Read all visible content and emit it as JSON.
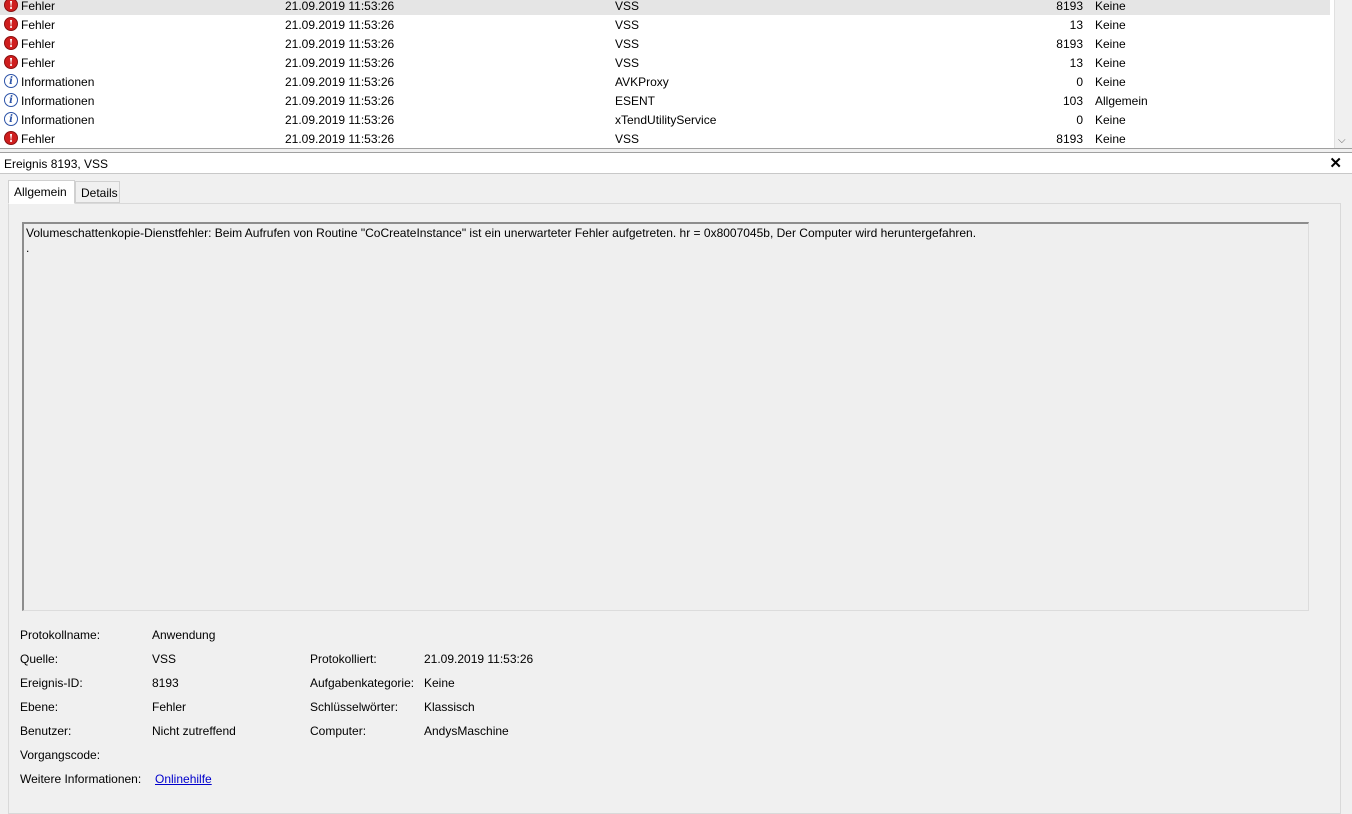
{
  "events": [
    {
      "level": "Fehler",
      "type": "error",
      "date": "21.09.2019 11:53:26",
      "source": "VSS",
      "id": "8193",
      "category": "Keine",
      "selected": true
    },
    {
      "level": "Fehler",
      "type": "error",
      "date": "21.09.2019 11:53:26",
      "source": "VSS",
      "id": "13",
      "category": "Keine"
    },
    {
      "level": "Fehler",
      "type": "error",
      "date": "21.09.2019 11:53:26",
      "source": "VSS",
      "id": "8193",
      "category": "Keine"
    },
    {
      "level": "Fehler",
      "type": "error",
      "date": "21.09.2019 11:53:26",
      "source": "VSS",
      "id": "13",
      "category": "Keine"
    },
    {
      "level": "Informationen",
      "type": "info",
      "date": "21.09.2019 11:53:26",
      "source": "AVKProxy",
      "id": "0",
      "category": "Keine"
    },
    {
      "level": "Informationen",
      "type": "info",
      "date": "21.09.2019 11:53:26",
      "source": "ESENT",
      "id": "103",
      "category": "Allgemein"
    },
    {
      "level": "Informationen",
      "type": "info",
      "date": "21.09.2019 11:53:26",
      "source": "xTendUtilityService",
      "id": "0",
      "category": "Keine"
    },
    {
      "level": "Fehler",
      "type": "error",
      "date": "21.09.2019 11:53:26",
      "source": "VSS",
      "id": "8193",
      "category": "Keine"
    }
  ],
  "icons": {
    "error": "error-icon",
    "info": "info-icon",
    "error_glyph": "!",
    "info_glyph": "i"
  },
  "detail": {
    "title": "Ereignis 8193, VSS",
    "close": "✕",
    "tabs": [
      {
        "label": "Allgemein",
        "active": true
      },
      {
        "label": "Details",
        "active": false
      }
    ],
    "message": "Volumeschattenkopie-Dienstfehler: Beim Aufrufen von Routine \"CoCreateInstance\" ist ein unerwarteter Fehler aufgetreten. hr = 0x8007045b, Der Computer wird heruntergefahren.\n.",
    "props": {
      "logname_label": "Protokollname:",
      "logname": "Anwendung",
      "source_label": "Quelle:",
      "source": "VSS",
      "logged_label": "Protokolliert:",
      "logged": "21.09.2019 11:53:26",
      "eventid_label": "Ereignis-ID:",
      "eventid": "8193",
      "taskcat_label": "Aufgabenkategorie:",
      "taskcat": "Keine",
      "level_label": "Ebene:",
      "level": "Fehler",
      "keywords_label": "Schlüsselwörter:",
      "keywords": "Klassisch",
      "user_label": "Benutzer:",
      "user": "Nicht zutreffend",
      "computer_label": "Computer:",
      "computer": "AndysMaschine",
      "opcode_label": "Vorgangscode:",
      "opcode": "",
      "moreinfo_label": "Weitere Informationen:",
      "moreinfo_link": "Onlinehilfe"
    }
  },
  "colors": {
    "error": "#cf1e1e",
    "info": "#2d54a8",
    "link": "#0000cc",
    "selected_row": "#e5e5e5"
  }
}
